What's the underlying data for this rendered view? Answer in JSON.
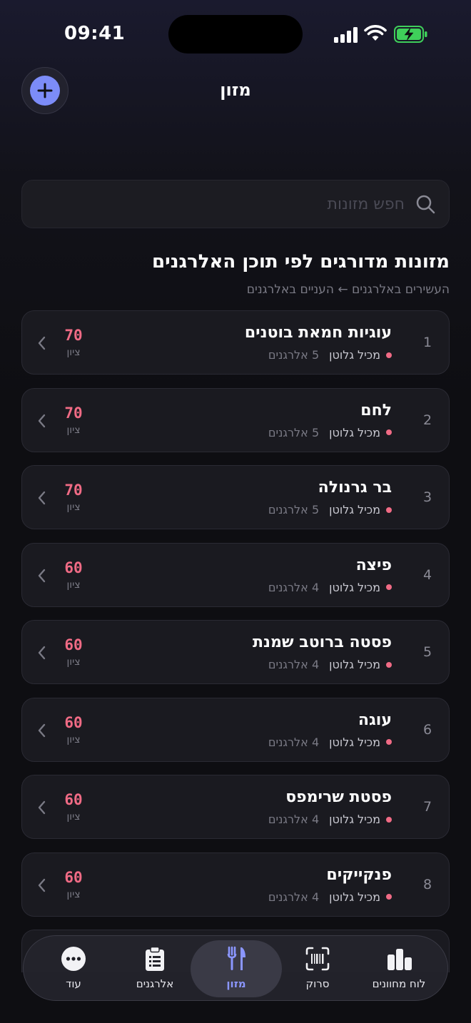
{
  "status_bar": {
    "time": "09:41"
  },
  "nav": {
    "title": "מזון"
  },
  "search": {
    "placeholder": "חפש מזונות"
  },
  "section": {
    "title": "מזונות מדורגים לפי תוכן האלרגנים",
    "subtitle": "העשירים באלרגנים ← העניים באלרגנים"
  },
  "foods": [
    {
      "rank": "1",
      "name": "עוגיות חמאת בוטנים",
      "tag": "מכיל גלוטן",
      "count": "5 אלרגנים",
      "score": "70",
      "score_label": "ציון"
    },
    {
      "rank": "2",
      "name": "לחם",
      "tag": "מכיל גלוטן",
      "count": "5 אלרגנים",
      "score": "70",
      "score_label": "ציון"
    },
    {
      "rank": "3",
      "name": "בר גרנולה",
      "tag": "מכיל גלוטן",
      "count": "5 אלרגנים",
      "score": "70",
      "score_label": "ציון"
    },
    {
      "rank": "4",
      "name": "פיצה",
      "tag": "מכיל גלוטן",
      "count": "4 אלרגנים",
      "score": "60",
      "score_label": "ציון"
    },
    {
      "rank": "5",
      "name": "פסטה ברוטב שמנת",
      "tag": "מכיל גלוטן",
      "count": "4 אלרגנים",
      "score": "60",
      "score_label": "ציון"
    },
    {
      "rank": "6",
      "name": "עוגה",
      "tag": "מכיל גלוטן",
      "count": "4 אלרגנים",
      "score": "60",
      "score_label": "ציון"
    },
    {
      "rank": "7",
      "name": "פסטת שרימפס",
      "tag": "מכיל גלוטן",
      "count": "4 אלרגנים",
      "score": "60",
      "score_label": "ציון"
    },
    {
      "rank": "8",
      "name": "פנקייקים",
      "tag": "מכיל גלוטן",
      "count": "4 אלרגנים",
      "score": "60",
      "score_label": "ציון"
    }
  ],
  "tabs": {
    "more": "עוד",
    "allergens": "אלרגנים",
    "food": "מזון",
    "scan": "סרוק",
    "dashboard": "לוח מחוונים"
  },
  "colors": {
    "accent": "#7c8cf8",
    "score": "#f06b85",
    "background": "#0e0e12",
    "card": "#1a1a20"
  }
}
